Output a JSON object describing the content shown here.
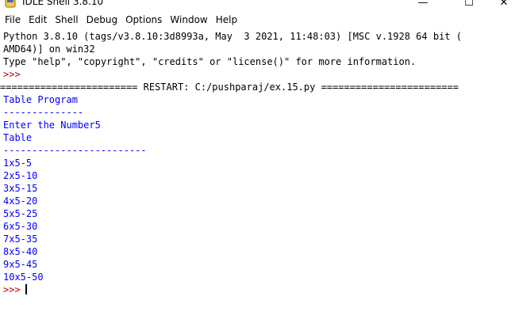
{
  "window": {
    "title": "IDLE Shell 3.8.10",
    "icon": "python-idle-icon",
    "controls": {
      "minimize": "—",
      "maximize": "☐",
      "close": "✕"
    }
  },
  "menu": {
    "items": [
      "File",
      "Edit",
      "Shell",
      "Debug",
      "Options",
      "Window",
      "Help"
    ]
  },
  "shell": {
    "banner_line1": "Python 3.8.10 (tags/v3.8.10:3d8993a, May  3 2021, 11:48:03) [MSC v.1928 64 bit (",
    "banner_line2": "AMD64)] on win32",
    "banner_line3": "Type \"help\", \"copyright\", \"credits\" or \"license()\" for more information.",
    "prompt": ">>>",
    "restart_line": "======================== RESTART: C:/pushparaj/ex.15.py ========================",
    "output": [
      "Table Program",
      "--------------",
      "Enter the Number5",
      "Table",
      "-------------------------",
      "1x5-5",
      "2x5-10",
      "3x5-15",
      "4x5-20",
      "5x5-25",
      "6x5-30",
      "7x5-35",
      "8x5-40",
      "9x5-45",
      "10x5-50"
    ],
    "final_prompt": ">>>"
  },
  "colors": {
    "output_text": "#0000ff",
    "prompt": "#c00000",
    "plain_text": "#000000",
    "background": "#ffffff"
  }
}
